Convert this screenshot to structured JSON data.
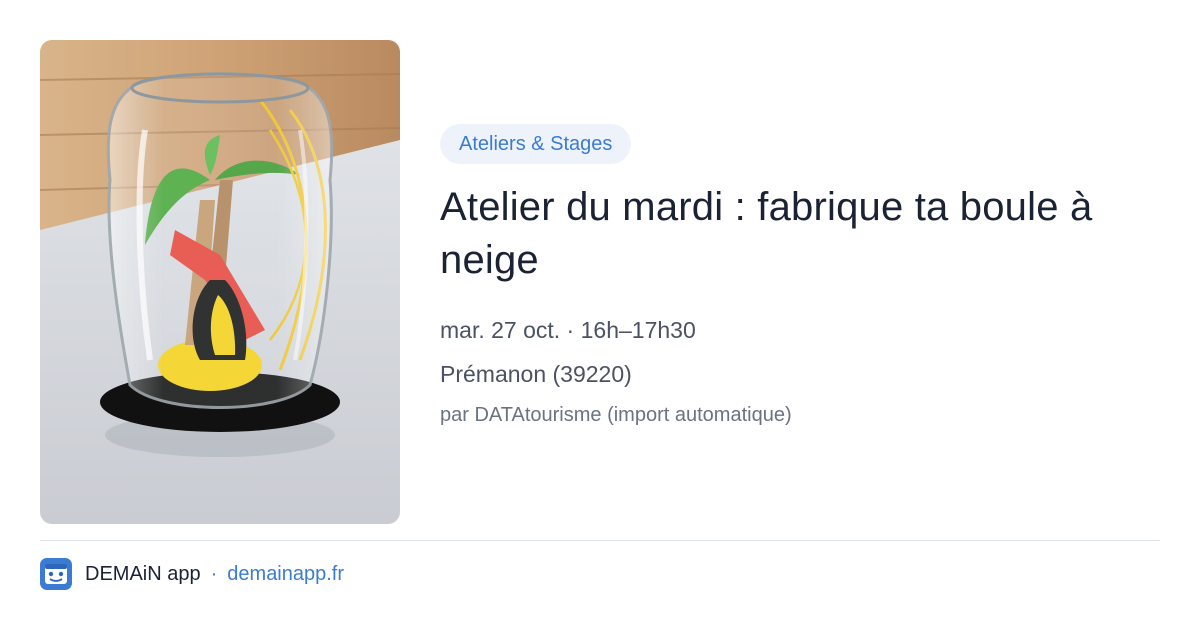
{
  "event": {
    "category": "Ateliers & Stages",
    "title": "Atelier du mardi : fabrique ta boule à neige",
    "date": "mar. 27 oct. · 16h–17h30",
    "place": "Prémanon (39220)",
    "source": "par DATAtourisme (import automatique)",
    "image_icon": "snow-globe-jar-photo"
  },
  "footer": {
    "app_name": "DEMAiN app",
    "separator": "·",
    "site": "demainapp.fr",
    "logo_icon": "demain-logo-icon"
  },
  "colors": {
    "accent": "#3b7bd1",
    "badge_bg": "#eef3fb",
    "text": "#1a2233",
    "muted": "#4a5263",
    "divider": "#dfe4ea"
  }
}
